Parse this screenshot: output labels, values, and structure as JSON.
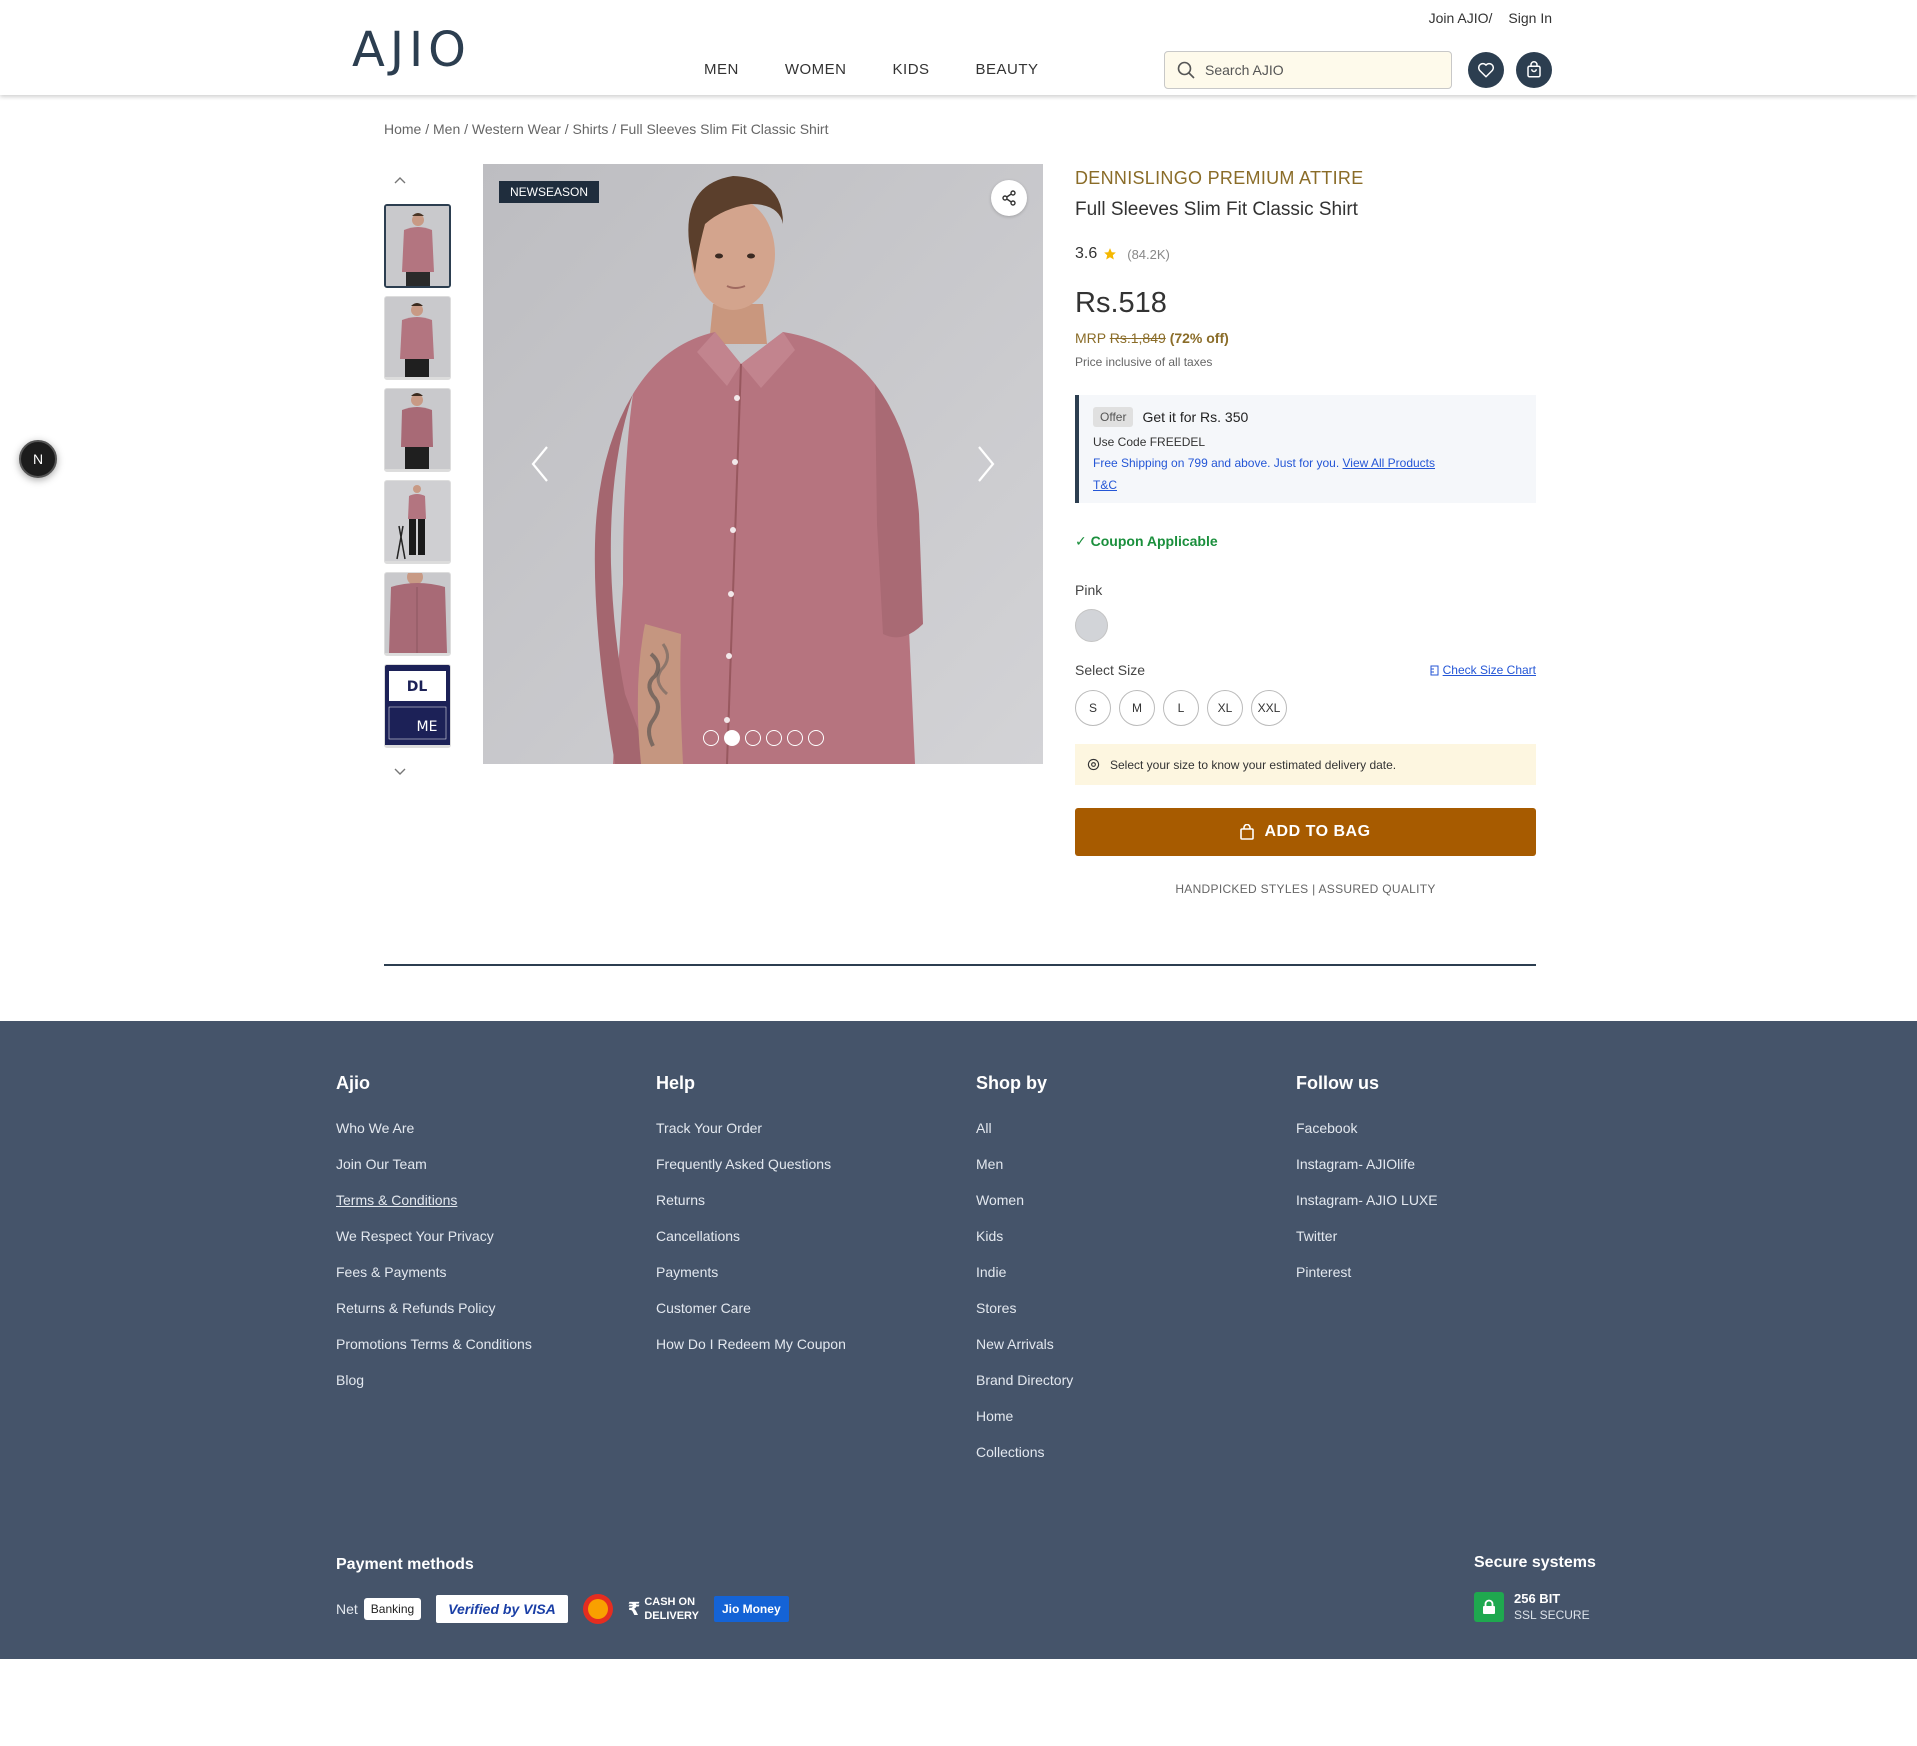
{
  "header": {
    "logo": "AJIO",
    "join_link": "Join AJIO/",
    "signin_link": "Sign In",
    "nav": [
      "MEN",
      "WOMEN",
      "KIDS",
      "BEAUTY"
    ],
    "search_placeholder": "Search AJIO",
    "icons": {
      "search": "search-icon",
      "wishlist": "heart-icon",
      "bag": "shopping-bag-icon"
    }
  },
  "breadcrumb": "Home / Men / Western Wear / Shirts / Full Sleeves Slim Fit Classic Shirt",
  "gallery": {
    "tag": "NEWSEASON",
    "thumbnail_count": 6,
    "active_dot": 2,
    "dot_count": 6
  },
  "product": {
    "brand": "DENNISLINGO PREMIUM ATTIRE",
    "name": "Full Sleeves Slim Fit Classic Shirt",
    "rating": "3.6",
    "rating_count": "(84.2K)",
    "price": "Rs.518",
    "mrp_label": "MRP",
    "mrp_value": "Rs.1,849",
    "discount": "(72% off)",
    "taxes_note": "Price inclusive of all taxes",
    "offer": {
      "pill": "Offer",
      "title": "Get it for Rs. 350",
      "code_label": "Use Code",
      "code": "FREEDEL",
      "shipping": "Free Shipping on 799 and above. Just for you.",
      "view_all": "View All Products",
      "tc": "T&C"
    },
    "coupon": "✓ Coupon Applicable",
    "color": "Pink",
    "swatch_color": "#d2d4d8",
    "select_size": "Select Size",
    "size_chart": "Check Size Chart",
    "sizes": [
      "S",
      "M",
      "L",
      "XL",
      "XXL"
    ],
    "delivery_note": "Select your size to know your estimated delivery date.",
    "add_to_bag": "ADD TO BAG",
    "assurance": "HANDPICKED STYLES | ASSURED QUALITY"
  },
  "footer": {
    "columns": [
      {
        "title": "Ajio",
        "links": [
          "Who We Are",
          "Join Our Team",
          "Terms & Conditions",
          "We Respect Your Privacy",
          "Fees & Payments",
          "Returns & Refunds Policy",
          "Promotions Terms & Conditions",
          "Blog"
        ]
      },
      {
        "title": "Help",
        "links": [
          "Track Your Order",
          "Frequently Asked Questions",
          "Returns",
          "Cancellations",
          "Payments",
          "Customer Care",
          "How Do I Redeem My Coupon"
        ]
      },
      {
        "title": "Shop by",
        "links": [
          "All",
          "Men",
          "Women",
          "Kids",
          "Indie",
          "Stores",
          "New Arrivals",
          "Brand Directory",
          "Home",
          "Collections"
        ]
      },
      {
        "title": "Follow us",
        "links": [
          "Facebook",
          "Instagram- AJIOlife",
          "Instagram- AJIO LUXE",
          "Twitter",
          "Pinterest"
        ]
      }
    ],
    "payment_title": "Payment methods",
    "net_label": "Net",
    "net_badge": "Banking",
    "visa": "Verified by VISA",
    "cod_symbol": "₹",
    "cod_line1": "CASH ON",
    "cod_line2": "DELIVERY",
    "jio": "Jio Money",
    "secure_title": "Secure systems",
    "ssl_line1": "256 BIT",
    "ssl_line2": "SSL SECURE"
  },
  "floating_badge": "N",
  "colors": {
    "brand": "#2c3e50",
    "accent_brown": "#a75b00",
    "brand_gold": "#8a6c28",
    "footer_bg": "#45546a",
    "link_blue": "#2456d6",
    "success_green": "#1a8f3c"
  }
}
